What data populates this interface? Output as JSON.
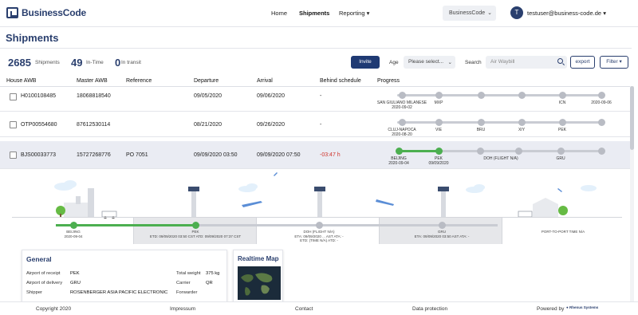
{
  "brand": {
    "name": "BusinessCode"
  },
  "nav": {
    "home": "Home",
    "shipments": "Shipments",
    "reporting": "Reporting"
  },
  "company_select": {
    "value": "BusinessCode"
  },
  "user": {
    "initial": "T",
    "email": "testuser@business-code.de"
  },
  "page": {
    "title": "Shipments"
  },
  "stats": [
    {
      "value": "2685",
      "label": "Shipments"
    },
    {
      "value": "49",
      "label": "In-Time"
    },
    {
      "value": "0",
      "label": "In transit"
    }
  ],
  "toolbar": {
    "invite_label": "Invite",
    "age_label": "Age",
    "age_placeholder": "Please select...",
    "search_label": "Search",
    "search_placeholder": "Air Waybill",
    "export_label": "export",
    "filter_label": "Filter"
  },
  "table": {
    "columns": [
      "House AWB",
      "Master AWB",
      "Reference",
      "Departure",
      "Arrival",
      "Behind schedule",
      "Progress"
    ],
    "rows": [
      {
        "house": "H0100108485",
        "master": "18068818540",
        "reference": "",
        "departure": "09/05/2020",
        "arrival": "09/06/2020",
        "behind": "-",
        "stops": [
          {
            "code": "SAN GIULIANO MILANESE",
            "date": "2020-09-02"
          },
          {
            "code": "MXP",
            "date": ""
          },
          {
            "code": "",
            "date": ""
          },
          {
            "code": "",
            "date": ""
          },
          {
            "code": "ICN",
            "date": ""
          },
          {
            "code": "2020-09-06",
            "date": ""
          }
        ]
      },
      {
        "house": "OTP00554680",
        "master": "87612530114",
        "reference": "",
        "departure": "08/21/2020",
        "arrival": "09/26/2020",
        "behind": "-",
        "stops": [
          {
            "code": "CLUJ-NAPOCA",
            "date": "2020-08-20"
          },
          {
            "code": "VIE",
            "date": ""
          },
          {
            "code": "BRU",
            "date": ""
          },
          {
            "code": "XIY",
            "date": ""
          },
          {
            "code": "PEK",
            "date": ""
          },
          {
            "code": "",
            "date": ""
          }
        ]
      },
      {
        "house": "BJS00033773",
        "master": "15727268776",
        "reference": "PO 7051",
        "departure": "09/09/2020 03:50",
        "arrival": "09/09/2020 07:50",
        "behind": "-03:47 h",
        "stops": [
          {
            "code": "BEIJING",
            "date": "2020-09-04"
          },
          {
            "code": "PEK",
            "date": "09/09/2020"
          },
          {
            "code": "DOH (FLIGHT N/A)",
            "date": ""
          },
          {
            "code": "GRU",
            "date": ""
          }
        ]
      }
    ]
  },
  "detail_timeline": {
    "stops": [
      {
        "line1": "BEIJING",
        "line2": "2020-09-04"
      },
      {
        "line1": "PEK",
        "line2": "ETD: 09/09/2020 03:50 CST ATD: 09/09/2020 07:37 CST"
      },
      {
        "line1": "DOH (FLIGHT N/A)",
        "line2": "ETA: 09/09/2020 ... AST ATA: -",
        "line3": "ETD: (TIME N/A)   ATD: -"
      },
      {
        "line1": "GRU",
        "line2": "ETA: 09/09/2020 03:50 AST ATA: -"
      },
      {
        "line1": "PORT-TO-PORT TIME N/A",
        "line2": ""
      }
    ]
  },
  "general": {
    "title": "General",
    "airport_receipt_label": "Airport of receipt",
    "airport_receipt": "PEK",
    "airport_delivery_label": "Airport of delivery",
    "airport_delivery": "GRU",
    "shipper_label": "Shipper",
    "shipper": "ROSENBERGER ASIA PACIFIC ELECTRONIC",
    "total_weight_label": "Total weight",
    "total_weight": "375 kg",
    "carrier_label": "Carrier",
    "carrier": "QR",
    "forwarder_label": "Forwarder",
    "forwarder": ""
  },
  "realtime_map": {
    "title": "Realtime Map"
  },
  "footer": {
    "copyright": "Copyright 2020",
    "impressum": "Impressum",
    "contact": "Contact",
    "data_protection": "Data protection",
    "powered_by": "Powered by",
    "powered_brand": "Rhenus Systems"
  },
  "colors": {
    "brand": "#2a3f6e",
    "green": "#4caf50",
    "red": "#d0342c",
    "grey_track": "#c9ccd3"
  }
}
